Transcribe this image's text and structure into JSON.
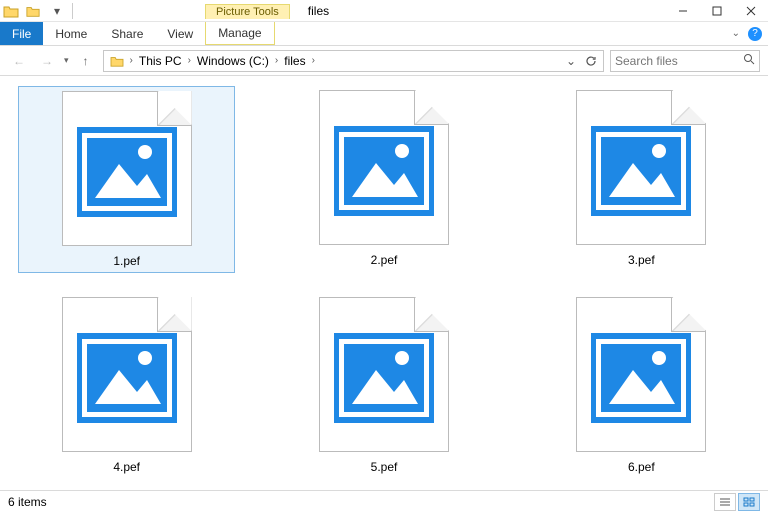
{
  "window": {
    "title": "files",
    "context_tab": "Picture Tools"
  },
  "ribbon": {
    "file": "File",
    "home": "Home",
    "share": "Share",
    "view": "View",
    "manage": "Manage"
  },
  "address": {
    "crumbs": [
      "This PC",
      "Windows (C:)",
      "files"
    ]
  },
  "search": {
    "placeholder": "Search files"
  },
  "files": [
    {
      "name": "1.pef",
      "selected": true
    },
    {
      "name": "2.pef",
      "selected": false
    },
    {
      "name": "3.pef",
      "selected": false
    },
    {
      "name": "4.pef",
      "selected": false
    },
    {
      "name": "5.pef",
      "selected": false
    },
    {
      "name": "6.pef",
      "selected": false
    }
  ],
  "status": {
    "count": "6 items"
  }
}
